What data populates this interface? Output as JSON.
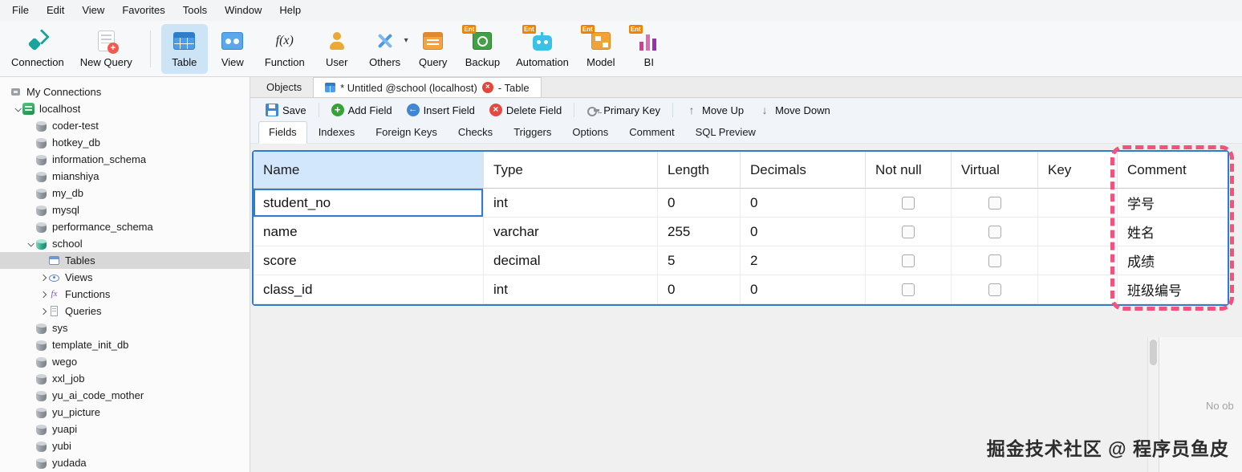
{
  "menu": {
    "items": [
      "File",
      "Edit",
      "View",
      "Favorites",
      "Tools",
      "Window",
      "Help"
    ]
  },
  "main_toolbar": {
    "buttons": [
      {
        "label": "Connection",
        "icon": "connection"
      },
      {
        "label": "New Query",
        "icon": "newquery"
      },
      {
        "label": "Table",
        "icon": "table",
        "selected": true,
        "sep_before": true
      },
      {
        "label": "View",
        "icon": "view"
      },
      {
        "label": "Function",
        "icon": "function"
      },
      {
        "label": "User",
        "icon": "user"
      },
      {
        "label": "Others",
        "icon": "others",
        "dropdown": true
      },
      {
        "label": "Query",
        "icon": "query"
      },
      {
        "label": "Backup",
        "icon": "backup",
        "badge": "Ent"
      },
      {
        "label": "Automation",
        "icon": "automation",
        "badge": "Ent"
      },
      {
        "label": "Model",
        "icon": "model",
        "badge": "Ent"
      },
      {
        "label": "BI",
        "icon": "bi",
        "badge": "Ent"
      }
    ]
  },
  "sidebar": {
    "items": [
      {
        "label": "My Connections",
        "level": 0,
        "icon": "connections",
        "chevron": null
      },
      {
        "label": "localhost",
        "level": 1,
        "icon": "server",
        "chevron": "down"
      },
      {
        "label": "coder-test",
        "level": 2,
        "icon": "db",
        "chevron": null
      },
      {
        "label": "hotkey_db",
        "level": 2,
        "icon": "db",
        "chevron": null
      },
      {
        "label": "information_schema",
        "level": 2,
        "icon": "db",
        "chevron": null
      },
      {
        "label": "mianshiya",
        "level": 2,
        "icon": "db",
        "chevron": null
      },
      {
        "label": "my_db",
        "level": 2,
        "icon": "db",
        "chevron": null
      },
      {
        "label": "mysql",
        "level": 2,
        "icon": "db",
        "chevron": null
      },
      {
        "label": "performance_schema",
        "level": 2,
        "icon": "db",
        "chevron": null
      },
      {
        "label": "school",
        "level": 2,
        "icon": "db-open",
        "chevron": "down"
      },
      {
        "label": "Tables",
        "level": 3,
        "icon": "tables",
        "chevron": null,
        "selected": true
      },
      {
        "label": "Views",
        "level": 3,
        "icon": "views",
        "chevron": "right"
      },
      {
        "label": "Functions",
        "level": 3,
        "icon": "functions",
        "chevron": "right"
      },
      {
        "label": "Queries",
        "level": 3,
        "icon": "queries",
        "chevron": "right"
      },
      {
        "label": "sys",
        "level": 2,
        "icon": "db",
        "chevron": null
      },
      {
        "label": "template_init_db",
        "level": 2,
        "icon": "db",
        "chevron": null
      },
      {
        "label": "wego",
        "level": 2,
        "icon": "db",
        "chevron": null
      },
      {
        "label": "xxl_job",
        "level": 2,
        "icon": "db",
        "chevron": null
      },
      {
        "label": "yu_ai_code_mother",
        "level": 2,
        "icon": "db",
        "chevron": null
      },
      {
        "label": "yu_picture",
        "level": 2,
        "icon": "db",
        "chevron": null
      },
      {
        "label": "yuapi",
        "level": 2,
        "icon": "db",
        "chevron": null
      },
      {
        "label": "yubi",
        "level": 2,
        "icon": "db",
        "chevron": null
      },
      {
        "label": "yudada",
        "level": 2,
        "icon": "db",
        "chevron": null
      }
    ]
  },
  "tabs": {
    "objects_label": "Objects",
    "active": {
      "title_before": "* Untitled @school (localhost)",
      "title_after": "- Table"
    }
  },
  "editor_toolbar": {
    "buttons": [
      {
        "label": "Save",
        "icon": "save",
        "sep_after": true
      },
      {
        "label": "Add Field",
        "icon": "add"
      },
      {
        "label": "Insert Field",
        "icon": "insert"
      },
      {
        "label": "Delete Field",
        "icon": "delete",
        "sep_after": true
      },
      {
        "label": "Primary Key",
        "icon": "key",
        "sep_after": true
      },
      {
        "label": "Move Up",
        "icon": "up"
      },
      {
        "label": "Move Down",
        "icon": "down"
      }
    ]
  },
  "editor_tabs": {
    "items": [
      "Fields",
      "Indexes",
      "Foreign Keys",
      "Checks",
      "Triggers",
      "Options",
      "Comment",
      "SQL Preview"
    ],
    "active": "Fields"
  },
  "fields_grid": {
    "columns": [
      "Name",
      "Type",
      "Length",
      "Decimals",
      "Not null",
      "Virtual",
      "Key",
      "Comment"
    ],
    "selected_column": "Name",
    "editing": {
      "row_index": 0,
      "column": "name"
    },
    "rows": [
      {
        "name": "student_no",
        "type": "int",
        "length": "0",
        "decimals": "0",
        "not_null": false,
        "virtual": false,
        "key": "",
        "comment": "学号"
      },
      {
        "name": "name",
        "type": "varchar",
        "length": "255",
        "decimals": "0",
        "not_null": false,
        "virtual": false,
        "key": "",
        "comment": "姓名"
      },
      {
        "name": "score",
        "type": "decimal",
        "length": "5",
        "decimals": "2",
        "not_null": false,
        "virtual": false,
        "key": "",
        "comment": "成绩"
      },
      {
        "name": "class_id",
        "type": "int",
        "length": "0",
        "decimals": "0",
        "not_null": false,
        "virtual": false,
        "key": "",
        "comment": "班级编号"
      }
    ]
  },
  "annotation": {
    "target": "comment-column",
    "color": "#f3527d"
  },
  "right_pane": {
    "text": "No ob"
  },
  "watermark": {
    "text": "掘金技术社区 @ 程序员鱼皮"
  },
  "colors": {
    "accent": "#2e7bd2",
    "selected_button_bg": "#cde4f7",
    "annotation": "#f3527d"
  }
}
